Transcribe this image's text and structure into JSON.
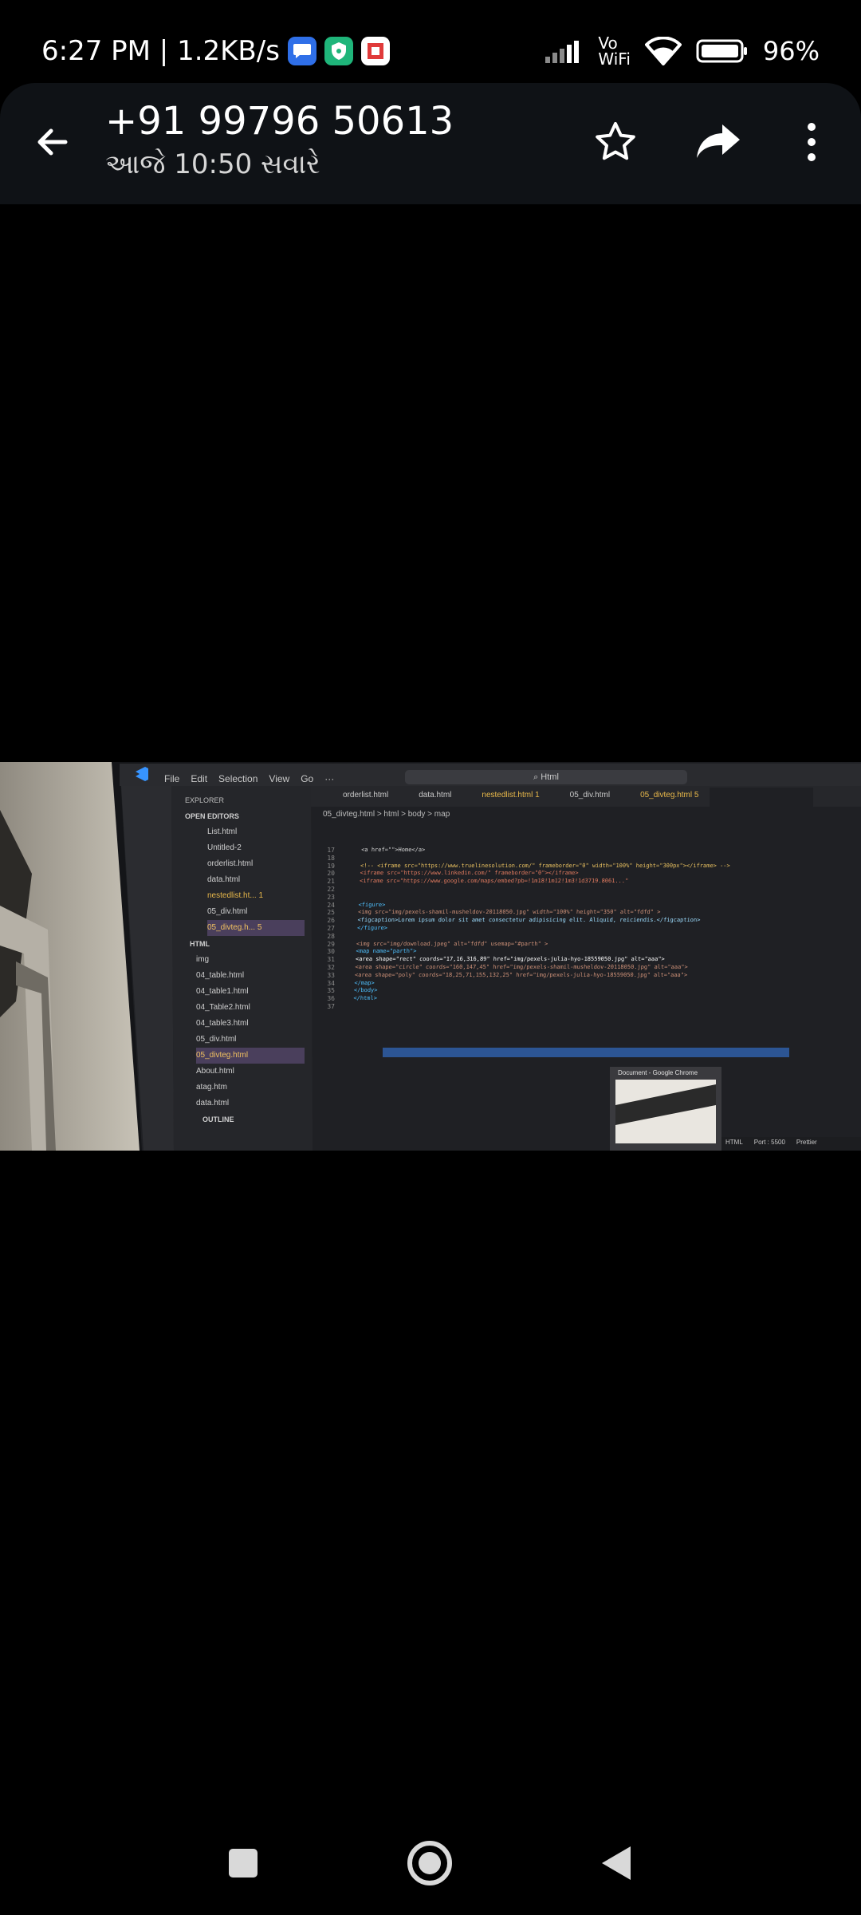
{
  "status_bar": {
    "time_speed": "6:27 PM | 1.2KB/s",
    "vowifi": "Vo\nWiFi",
    "battery": "96%"
  },
  "app_bar": {
    "title": "+91 99796 50613",
    "subtitle": "આજે 10:50 સવારે"
  },
  "photo": {
    "menu": [
      "File",
      "Edit",
      "Selection",
      "View",
      "Go",
      "···"
    ],
    "search": "Html",
    "explorer_title": "EXPLORER",
    "open_editors": "OPEN EDITORS",
    "open_files": [
      "List.html",
      "Untitled-2",
      "orderlist.html",
      "data.html",
      "nestedlist.ht... 1",
      "05_div.html",
      "05_divteg.h... 5"
    ],
    "html_folder": "HTML",
    "html_files": [
      "img",
      "04_table.html",
      "04_table1.html",
      "04_Table2.html",
      "04_table3.html",
      "05_div.html",
      "05_divteg.html",
      "About.html",
      "atag.htm",
      "data.html"
    ],
    "outline": "OUTLINE",
    "tabs": [
      "orderlist.html",
      "data.html",
      "nestedlist.html 1",
      "05_div.html",
      "05_divteg.html 5"
    ],
    "breadcrumb": "05_divteg.html > html > body > map",
    "line_numbers": [
      "17",
      "18",
      "19",
      "20",
      "21",
      "22",
      "23",
      "24",
      "25",
      "26",
      "27",
      "28",
      "29",
      "30",
      "31",
      "32",
      "33",
      "34",
      "35",
      "36",
      "37"
    ],
    "code_lines": [
      "<a href=\"\">Home</a>",
      "",
      "<!-- <iframe src=\"https://www.truelinesolution.com/\" frameborder=\"0\" width=\"100%\" height=\"300px\"></iframe> -->",
      "<iframe src=\"https://www.linkedin.com/\" frameborder=\"0\"></iframe>",
      "<iframe src=\"https://www.google.com/maps/embed?pb=!1m18!1m12!1m3!1d3719.8061...\"",
      "",
      "",
      "<figure>",
      "<img src=\"img/pexels-shamil-musheldov-20118050.jpg\" width=\"100%\" height=\"350\" alt=\"fdfd\" >",
      "<figcaption>Lorem ipsum dolor sit amet consectetur adipisicing elit. Aliquid, reiciendis.</figcaption>",
      "</figure>",
      "",
      "<img src=\"img/download.jpeg\" alt=\"fdfd\" usemap=\"#parth\" >",
      "<map name=\"parth\">",
      "<area shape=\"rect\" coords=\"17,16,316,89\" href=\"img/pexels-julia-hyo-18559050.jpg\" alt=\"aaa\">",
      "<area shape=\"circle\" coords=\"160,147,45\" href=\"img/pexels-shamil-musheldov-20118050.jpg\" alt=\"aaa\">",
      "<area shape=\"poly\" coords=\"18,25,71,155,132,25\" href=\"img/pexels-julia-hyo-18559050.jpg\" alt=\"aaa\">",
      "</map>",
      "</body>",
      "</html>",
      ""
    ],
    "popup_title": "Document - Google Chrome",
    "status_items": [
      "HTML",
      "Port : 5500",
      "Prettier"
    ]
  },
  "colors": {
    "app_bar_bg": "#0f1216",
    "vscode_bg": "#1e1e1e",
    "sidebar_bg": "#252526",
    "highlight_tab": "#e8b84a",
    "accent": "#3794ff"
  }
}
